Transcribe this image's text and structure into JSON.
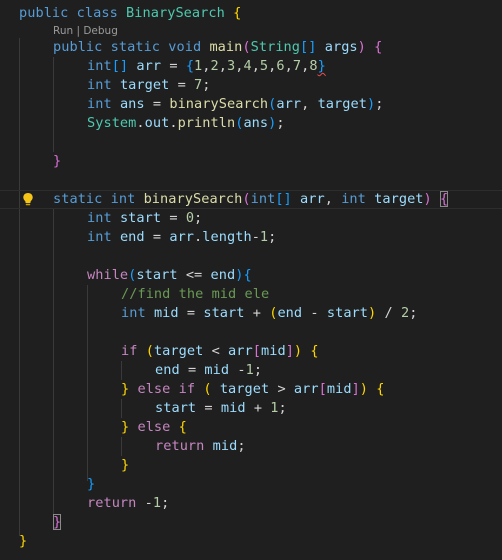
{
  "codelens": "Run | Debug",
  "lines": {
    "l1": [
      "public",
      " ",
      "class",
      " ",
      "BinarySearch",
      " ",
      "{"
    ],
    "l2": [
      "public",
      " ",
      "static",
      " ",
      "void",
      " ",
      "main",
      "(",
      "String",
      "[]",
      " ",
      "args",
      ")",
      " ",
      "{"
    ],
    "l3": [
      "int",
      "[]",
      " ",
      "arr",
      " ",
      "=",
      " ",
      "{",
      "1",
      ",",
      "2",
      ",",
      "3",
      ",",
      "4",
      ",",
      "5",
      ",",
      "6",
      ",",
      "7",
      ",",
      "8",
      "}"
    ],
    "l4": [
      "int",
      " ",
      "target",
      " ",
      "=",
      " ",
      "7",
      ";"
    ],
    "l5": [
      "int",
      " ",
      "ans",
      " ",
      "=",
      " ",
      "binarySearch",
      "(",
      "arr",
      ",",
      " ",
      "target",
      ")",
      ";"
    ],
    "l6": [
      "System",
      ".",
      "out",
      ".",
      "println",
      "(",
      "ans",
      ")",
      ";"
    ],
    "l8": [
      "}"
    ],
    "l10": [
      "static",
      " ",
      "int",
      " ",
      "binarySearch",
      "(",
      "int",
      "[]",
      " ",
      "arr",
      ",",
      " ",
      "int",
      " ",
      "target",
      ")",
      " ",
      "{"
    ],
    "l11": [
      "int",
      " ",
      "start",
      " ",
      "=",
      " ",
      "0",
      ";"
    ],
    "l12": [
      "int",
      " ",
      "end",
      " ",
      "=",
      " ",
      "arr",
      ".",
      "length",
      "-",
      "1",
      ";"
    ],
    "l14": [
      "while",
      "(",
      "start",
      " ",
      "<=",
      " ",
      "end",
      ")",
      "{"
    ],
    "l15": [
      "//find the mid ele"
    ],
    "l16": [
      "int",
      " ",
      "mid",
      " ",
      "=",
      " ",
      "start",
      " ",
      "+",
      " ",
      "(",
      "end",
      " ",
      "-",
      " ",
      "start",
      ")",
      " ",
      "/",
      " ",
      "2",
      ";"
    ],
    "l18": [
      "if",
      " ",
      "(",
      "target",
      " ",
      "<",
      " ",
      "arr",
      "[",
      "mid",
      "]",
      ")",
      " ",
      "{"
    ],
    "l19": [
      "end",
      " ",
      "=",
      " ",
      "mid",
      " ",
      "-",
      "1",
      ";"
    ],
    "l20": [
      "}",
      " ",
      "else",
      " ",
      "if",
      " ",
      "(",
      " ",
      "target",
      " ",
      ">",
      " ",
      "arr",
      "[",
      "mid",
      "]",
      ")",
      " ",
      "{"
    ],
    "l21": [
      "start",
      " ",
      "=",
      " ",
      "mid",
      " ",
      "+",
      " ",
      "1",
      ";"
    ],
    "l22": [
      "}",
      " ",
      "else",
      " ",
      "{"
    ],
    "l23": [
      "return",
      " ",
      "mid",
      ";"
    ],
    "l24": [
      "}"
    ],
    "l25": [
      "}"
    ],
    "l26": [
      "return",
      " ",
      "-",
      "1",
      ";"
    ],
    "l27": [
      "}"
    ],
    "l28": [
      "}"
    ]
  },
  "colors": {
    "background": "#1f1f1f",
    "keyword": "#569cd6",
    "type": "#4ec9b0",
    "function": "#dcdcaa",
    "variable": "#9cdcfe",
    "number": "#b5cea8",
    "control": "#c586c0",
    "comment": "#6a9955",
    "bracket_gold": "#ffd700",
    "bracket_orchid": "#da70d6",
    "bracket_blue": "#179fff"
  },
  "icons": {
    "lightbulb": "lightbulb-icon"
  }
}
